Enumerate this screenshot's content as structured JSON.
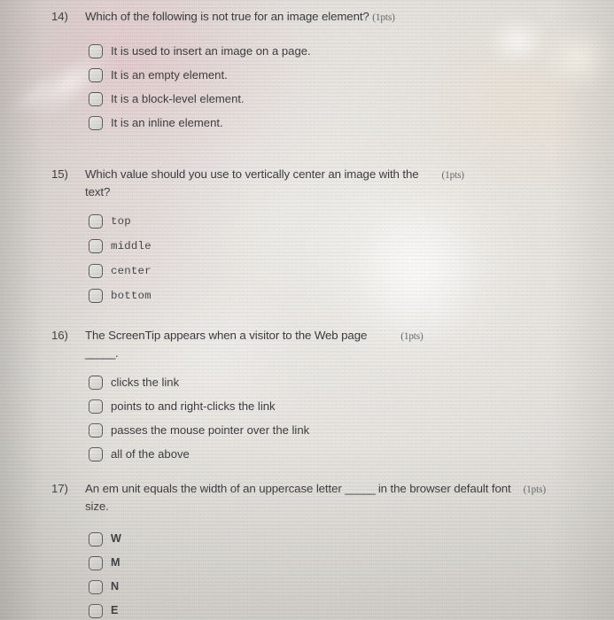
{
  "document": {
    "type": "online-quiz-screenshot",
    "questions": [
      {
        "number": "14)",
        "text": "Which of the following is not true for an image element?",
        "points": "(1pts)",
        "points_inline": true,
        "option_style": "sans",
        "options": [
          "It is used to insert an image on a page.",
          "It is an empty element.",
          "It is a block-level element.",
          "It is an inline element."
        ]
      },
      {
        "number": "15)",
        "text": "Which value should you use to vertically center an image with the text?",
        "points": "(1pts)",
        "points_inline": false,
        "option_style": "mono",
        "options": [
          "top",
          "middle",
          "center",
          "bottom"
        ]
      },
      {
        "number": "16)",
        "text": "The ScreenTip appears when a visitor to the Web page _____.",
        "points": "(1pts)",
        "points_inline": false,
        "option_style": "sans",
        "options": [
          "clicks the link",
          "points to and right-clicks the link",
          "passes the mouse pointer over the link",
          "all of the above"
        ]
      },
      {
        "number": "17)",
        "text": "An em unit equals the width of an uppercase letter _____ in the browser default font size.",
        "points": "(1pts)",
        "points_inline": false,
        "option_style": "letter",
        "options": [
          "W",
          "M",
          "N",
          "E"
        ]
      }
    ]
  },
  "q14": {
    "number": "14)",
    "text_part1": "Which of the following is not true for an image element?",
    "points": "(1pts)",
    "options": [
      "It is used to insert an image on a page.",
      "It is an empty element.",
      "It is a block-level element.",
      "It is an inline element."
    ]
  },
  "q15": {
    "number": "15)",
    "text_line1": "Which value should you use to vertically center an image with the",
    "text_line2": "text?",
    "points": "(1pts)",
    "options": [
      "top",
      "middle",
      "center",
      "bottom"
    ]
  },
  "q16": {
    "number": "16)",
    "text_line1": "The ScreenTip appears when a visitor to the Web page",
    "text_line2": "_____.",
    "points": "(1pts)",
    "options": [
      "clicks the link",
      "points to and right-clicks the link",
      "passes the mouse pointer over the link",
      "all of the above"
    ]
  },
  "q17": {
    "number": "17)",
    "text_before_blank": "An em unit equals the width of an uppercase letter",
    "blank": "_____",
    "text_after_blank": "in the browser default font",
    "text_line2": "size.",
    "points": "(1pts)",
    "options": [
      "W",
      "M",
      "N",
      "E"
    ]
  },
  "colors": {
    "text": "#2f3033",
    "points_text": "#55585c",
    "radio_border": "#4b4d50",
    "paper": "#e4e1dc"
  }
}
